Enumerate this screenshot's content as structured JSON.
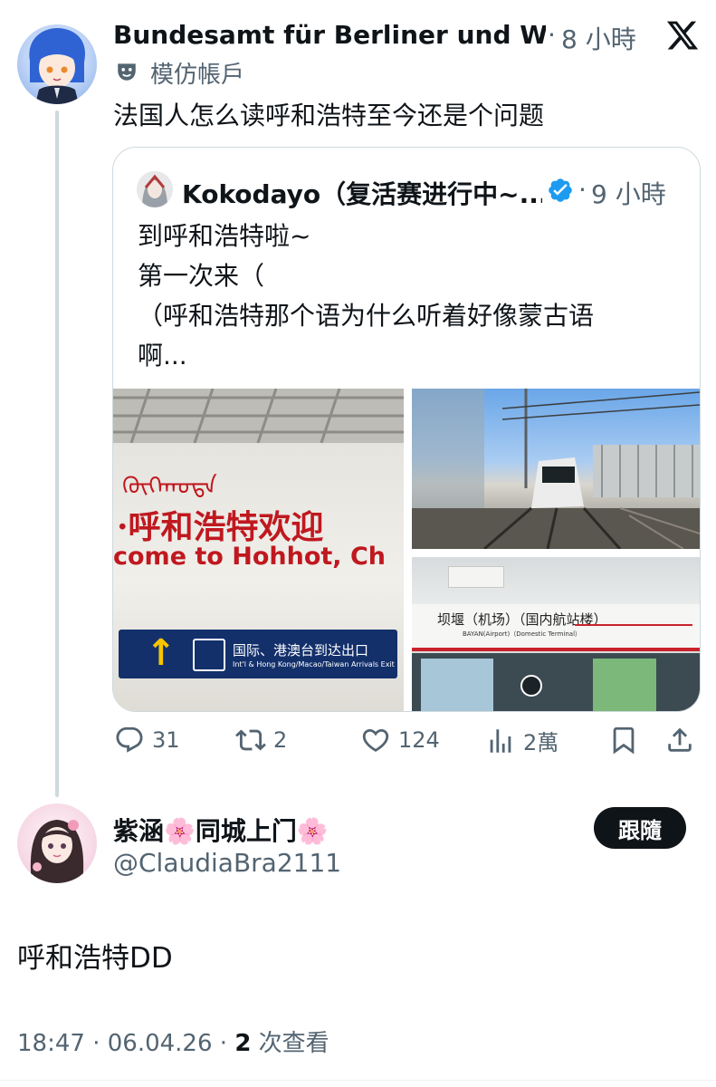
{
  "quoted_post": {
    "author_name": "Bundesamt für Berliner und Wei...",
    "dot": "·",
    "time": "8 小時",
    "account_label": "模仿帳戶",
    "text": "法国人怎么读呼和浩特至今还是个问题",
    "embed": {
      "author_name": "Kokodayo（复活赛进行中~...",
      "verified": true,
      "dot": "·",
      "time": "9 小時",
      "text_lines": [
        "到呼和浩特啦~",
        "第一次来（",
        "（呼和浩特那个语为什么听着好像蒙古语",
        "啊..."
      ],
      "images": [
        {
          "name": "airport-sign-photo",
          "mongolian": "ᠬᠥᠬᠡᠬᠣᠲᠠ",
          "chinese": "·呼和浩特欢迎",
          "english": "come to Hohhot, Ch",
          "sign_cn": "国际、港澳台到达出口",
          "sign_en": "Int'l & Hong Kong/Macao/Taiwan Arrivals Exit"
        },
        {
          "name": "train-platform-photo"
        },
        {
          "name": "station-sign-photo",
          "station_cn": "坝堰（机场）（国内航站楼）",
          "station_en": "BAYAN(Airport)（Domestic Terminal）"
        }
      ]
    },
    "actions": {
      "replies": "31",
      "reposts": "2",
      "likes": "124",
      "views": "2萬"
    }
  },
  "reply_post": {
    "author_name": "紫涵🌸同城上门🌸",
    "handle": "@ClaudiaBra2111",
    "follow_label": "跟隨",
    "text": "呼和浩特DD",
    "meta": {
      "time": "18:47",
      "dot1": "·",
      "date": "06.04.26",
      "dot2": "·",
      "view_count": "2",
      "view_label": "次查看"
    }
  },
  "colors": {
    "text": "#0f1419",
    "muted": "#536471",
    "border": "#cfd9de",
    "verified": "#1d9bf0",
    "button_bg": "#0f1419"
  }
}
